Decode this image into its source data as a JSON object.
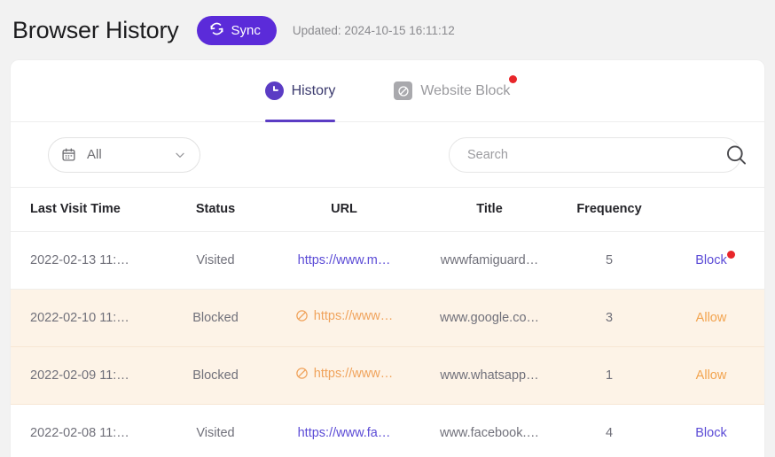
{
  "header": {
    "title": "Browser History",
    "sync_label": "Sync",
    "sync_icon": "refresh-icon",
    "updated_text": "Updated: 2024-10-15 16:11:12",
    "accent_color": "#5b2bd9"
  },
  "tabs": [
    {
      "label": "History",
      "icon": "clock-icon",
      "active": true,
      "badge": false
    },
    {
      "label": "Website Block",
      "icon": "block-circle-icon",
      "active": false,
      "badge": true
    }
  ],
  "filters": {
    "date_filter_label": "All",
    "date_filter_icon": "calendar-icon",
    "date_filter_chevron": "chevron-down-icon",
    "search_placeholder": "Search",
    "search_value": "",
    "search_icon": "search-icon"
  },
  "table": {
    "columns": [
      "Last Visit Time",
      "Status",
      "URL",
      "Title",
      "Frequency",
      ""
    ],
    "rows": [
      {
        "time": "2022-02-13 11:…",
        "status": "Visited",
        "url": "https://www.m…",
        "title": "wwwfamiguard…",
        "frequency": "5",
        "action": "Block",
        "blocked": false,
        "action_badge": true
      },
      {
        "time": "2022-02-10 11:…",
        "status": "Blocked",
        "url": "https://www…",
        "title": "www.google.co…",
        "frequency": "3",
        "action": "Allow",
        "blocked": true,
        "action_badge": false
      },
      {
        "time": "2022-02-09 11:…",
        "status": "Blocked",
        "url": "https://www…",
        "title": "www.whatsapp…",
        "frequency": "1",
        "action": "Allow",
        "blocked": true,
        "action_badge": false
      },
      {
        "time": "2022-02-08 11:…",
        "status": "Visited",
        "url": "https://www.fa…",
        "title": "www.facebook.…",
        "frequency": "4",
        "action": "Block",
        "blocked": false,
        "action_badge": false
      }
    ]
  },
  "colors": {
    "purple": "#5b3cc4",
    "link_purple": "#5b4bd6",
    "orange": "#f0a35c",
    "badge_red": "#e8262a",
    "blocked_row_bg": "#fdf3e7",
    "page_bg": "#f2f2f2"
  }
}
